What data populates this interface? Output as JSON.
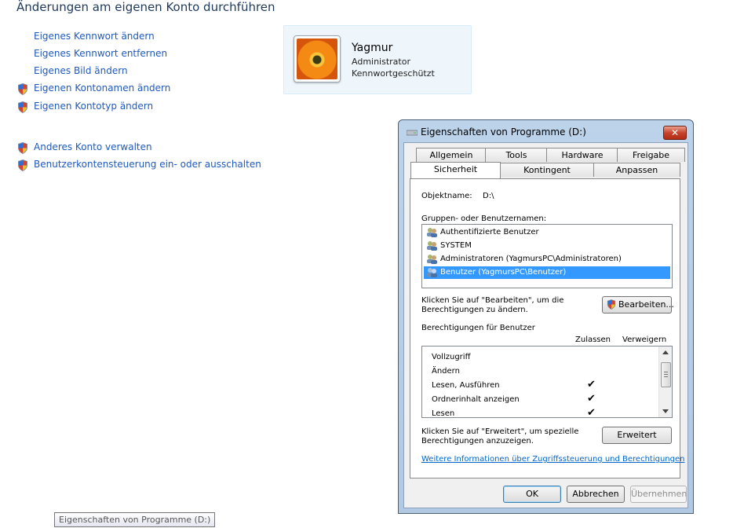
{
  "page_title": "Änderungen am eigenen Konto durchführen",
  "tasks": [
    {
      "label": "Eigenes Kennwort ändern",
      "shield": false
    },
    {
      "label": "Eigenes Kennwort entfernen",
      "shield": false
    },
    {
      "label": "Eigenes Bild ändern",
      "shield": false
    },
    {
      "label": "Eigenen Kontonamen ändern",
      "shield": true
    },
    {
      "label": "Eigenen Kontotyp ändern",
      "shield": true
    },
    {
      "label": "Anderes Konto verwalten",
      "shield": true
    },
    {
      "label": "Benutzerkontensteuerung ein- oder ausschalten",
      "shield": true
    }
  ],
  "user": {
    "name": "Yagmur",
    "role": "Administrator",
    "status": "Kennwortgeschützt"
  },
  "dialog": {
    "title": "Eigenschaften von Programme (D:)",
    "close_label": "✕",
    "tabs_row1": [
      "Allgemein",
      "Tools",
      "Hardware",
      "Freigabe"
    ],
    "tabs_row2": [
      "Sicherheit",
      "Kontingent",
      "Anpassen"
    ],
    "active_tab": "Sicherheit",
    "object_label": "Objektname:",
    "object_value": "D:\\",
    "groups_label": "Gruppen- oder Benutzernamen:",
    "groups": [
      "Authentifizierte Benutzer",
      "SYSTEM",
      "Administratoren (YagmursPC\\Administratoren)",
      "Benutzer (YagmursPC\\Benutzer)"
    ],
    "selected_group_index": 3,
    "edit_hint_line1": "Klicken Sie auf \"Bearbeiten\", um die",
    "edit_hint_line2": "Berechtigungen zu ändern.",
    "edit_button": "Bearbeiten...",
    "permissions_label": "Berechtigungen für Benutzer",
    "col_allow": "Zulassen",
    "col_deny": "Verweigern",
    "permissions": [
      {
        "name": "Vollzugriff",
        "allow": false
      },
      {
        "name": "Ändern",
        "allow": false
      },
      {
        "name": "Lesen, Ausführen",
        "allow": true
      },
      {
        "name": "Ordnerinhalt anzeigen",
        "allow": true
      },
      {
        "name": "Lesen",
        "allow": true
      }
    ],
    "check_glyph": "✔",
    "advanced_hint_line1": "Klicken Sie auf \"Erweitert\", um spezielle",
    "advanced_hint_line2": "Berechtigungen anzuzeigen.",
    "advanced_button": "Erweitert",
    "info_link": "Weitere Informationen über Zugriffssteuerung und Berechtigungen",
    "ok_button": "OK",
    "cancel_button": "Abbrechen",
    "apply_button": "Übernehmen"
  },
  "taskbar_tooltip": "Eigenschaften von Programme (D:)"
}
